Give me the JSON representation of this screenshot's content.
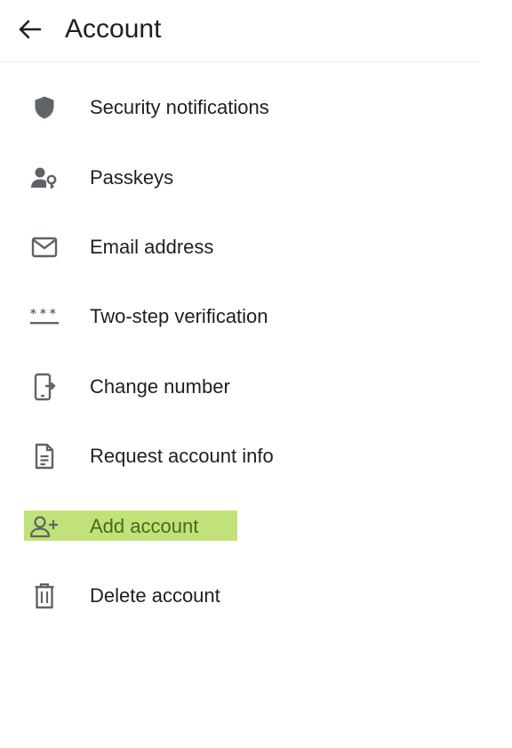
{
  "header": {
    "title": "Account",
    "back_icon": "arrow-left-icon"
  },
  "menu": {
    "items": [
      {
        "label": "Security notifications",
        "icon": "shield-icon"
      },
      {
        "label": "Passkeys",
        "icon": "person-key-icon"
      },
      {
        "label": "Email address",
        "icon": "envelope-icon"
      },
      {
        "label": "Two-step verification",
        "icon": "password-dots-icon"
      },
      {
        "label": "Change number",
        "icon": "phone-transfer-icon"
      },
      {
        "label": "Request account info",
        "icon": "document-icon"
      },
      {
        "label": "Add account",
        "icon": "person-add-icon",
        "highlighted": true
      },
      {
        "label": "Delete account",
        "icon": "trash-icon"
      }
    ]
  },
  "colors": {
    "text": "#1f1f1f",
    "icon": "#5f6368",
    "highlight": "#c0e279",
    "highlight_text": "#4a6a1a",
    "divider": "#ececec"
  }
}
